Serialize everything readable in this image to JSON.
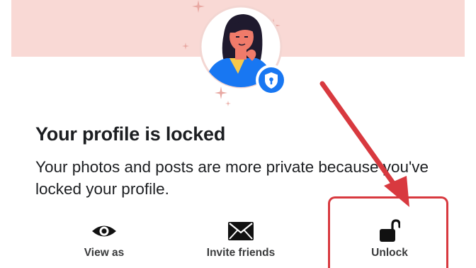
{
  "profile": {
    "title": "Your profile is locked",
    "description": "Your photos and posts are more private because you've locked your profile."
  },
  "actions": [
    {
      "label": "View as",
      "icon": "eye-icon"
    },
    {
      "label": "Invite friends",
      "icon": "envelope-icon"
    },
    {
      "label": "Unlock",
      "icon": "unlocked-padlock-icon"
    }
  ],
  "colors": {
    "banner": "#f9d9d5",
    "accent_blue": "#1877f2",
    "annotation_red": "#d8393f",
    "text": "#1c1e21"
  }
}
